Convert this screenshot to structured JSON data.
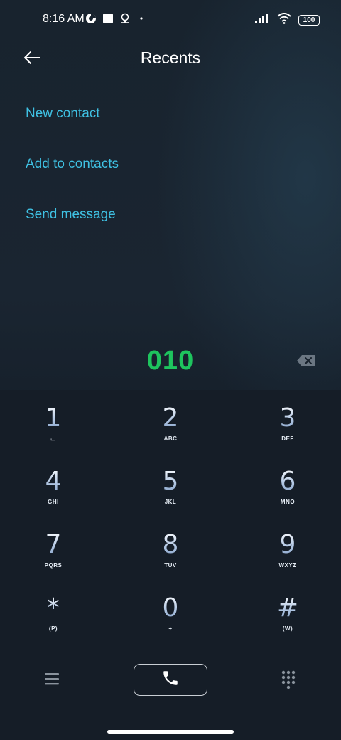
{
  "status_bar": {
    "time": "8:16 AM",
    "battery": "100",
    "icons": [
      "data-saver-icon",
      "square-notification-icon",
      "location-icon",
      "dot-icon",
      "signal-icon",
      "wifi-icon",
      "battery-icon"
    ]
  },
  "header": {
    "title": "Recents",
    "back_icon": "back-arrow-icon"
  },
  "actions": [
    {
      "label": "New contact"
    },
    {
      "label": "Add to contacts"
    },
    {
      "label": "Send message"
    }
  ],
  "dialer": {
    "number": "010",
    "backspace_icon": "backspace-icon"
  },
  "keypad": [
    {
      "digit": "1",
      "letters": "⌴"
    },
    {
      "digit": "2",
      "letters": "ABC"
    },
    {
      "digit": "3",
      "letters": "DEF"
    },
    {
      "digit": "4",
      "letters": "GHI"
    },
    {
      "digit": "5",
      "letters": "JKL"
    },
    {
      "digit": "6",
      "letters": "MNO"
    },
    {
      "digit": "7",
      "letters": "PQRS"
    },
    {
      "digit": "8",
      "letters": "TUV"
    },
    {
      "digit": "9",
      "letters": "WXYZ"
    },
    {
      "digit": "*",
      "letters": "(P)"
    },
    {
      "digit": "0",
      "letters": "+"
    },
    {
      "digit": "#",
      "letters": "(W)"
    }
  ],
  "bottom_bar": {
    "menu_icon": "menu-icon",
    "call_icon": "phone-icon",
    "dialpad_icon": "dialpad-icon"
  },
  "colors": {
    "accent": "#3fc1e3",
    "number": "#1ec45e",
    "background": "#16202b"
  }
}
